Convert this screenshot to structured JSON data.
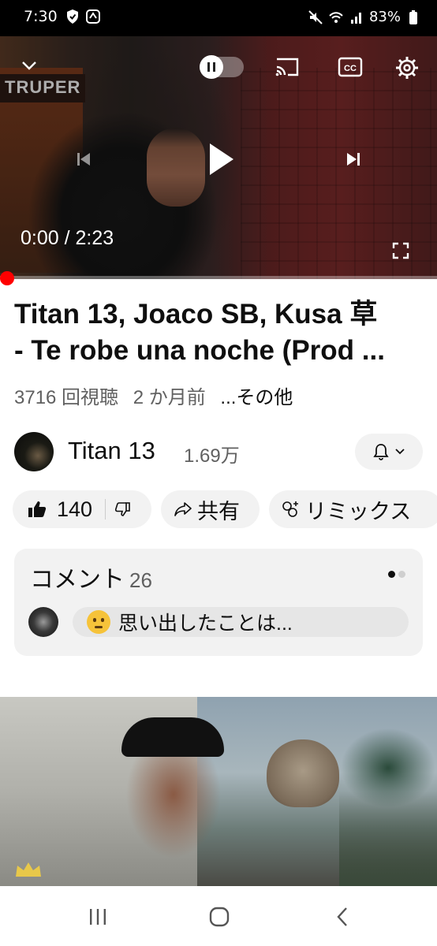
{
  "status_bar": {
    "time": "7:30",
    "battery": "83%",
    "icons": [
      "shield-icon",
      "sync-icon",
      "mute-icon",
      "wifi-icon",
      "signal-icon",
      "battery-icon"
    ]
  },
  "player": {
    "time_display": "0:00 / 2:23",
    "progress": 0,
    "controls": [
      "collapse-icon",
      "pause-toggle",
      "cast-icon",
      "captions-icon",
      "settings-icon",
      "previous-icon",
      "play-icon",
      "next-icon",
      "fullscreen-icon"
    ]
  },
  "video": {
    "title_line1": "Titan 13, Joaco SB, Kusa 草",
    "title_line2": "- Te robe una noche (Prod ...",
    "views": "3716 回視聴",
    "age": "2 か月前",
    "more": "...その他"
  },
  "channel": {
    "name": "Titan 13",
    "subscribers": "1.69万"
  },
  "actions": {
    "likes": "140",
    "share": "共有",
    "remix": "リミックス"
  },
  "comments": {
    "label": "コメント",
    "count": "26",
    "preview": "思い出したことは..."
  },
  "colors": {
    "accent_red": "#ff0000",
    "pill_bg": "#f2f2f2",
    "text_primary": "#0f0f0f",
    "text_secondary": "#606060"
  }
}
